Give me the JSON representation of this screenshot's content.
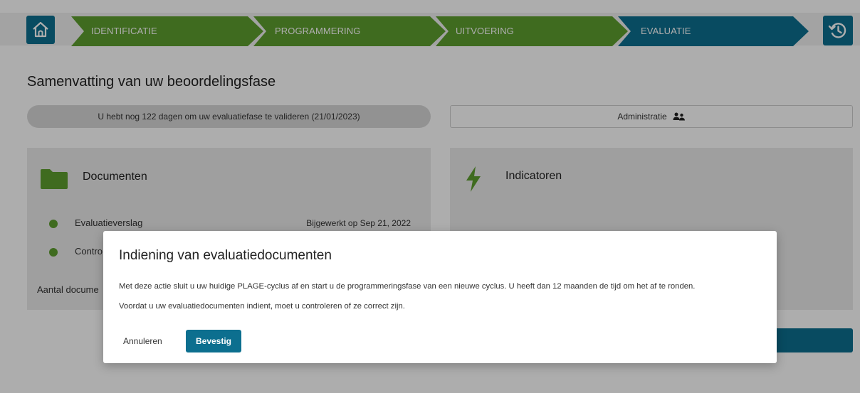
{
  "stepper": {
    "steps": [
      {
        "label": "IDENTIFICATIE",
        "status": "done"
      },
      {
        "label": "PROGRAMMERING",
        "status": "done"
      },
      {
        "label": "UITVOERING",
        "status": "done"
      },
      {
        "label": "EVALUATIE",
        "status": "active"
      }
    ],
    "home_icon": "home-icon",
    "history_icon": "history-icon"
  },
  "page": {
    "title": "Samenvatting van uw beoordelingsfase",
    "deadline_text": "U hebt nog 122 dagen om uw evaluatiefase te valideren (21/01/2023)",
    "admin_label": "Administratie",
    "admin_icon": "users-icon"
  },
  "documents_card": {
    "title": "Documenten",
    "icon": "folder-icon",
    "items": [
      {
        "name": "Evaluatieverslag",
        "status_text": "Bijgewerkt op Sep 21, 2022"
      },
      {
        "name": "Contro",
        "status_text": ""
      }
    ],
    "count_label": "Aantal docume"
  },
  "indicators_card": {
    "title": "Indicatoren",
    "icon": "lightning-icon"
  },
  "modal": {
    "title": "Indiening van evaluatiedocumenten",
    "line1": "Met deze actie sluit u uw huidige PLAGE-cyclus af en start u de programmeringsfase van een nieuwe cyclus. U heeft dan 12 maanden de tijd om het af te ronden.",
    "line2": "Voordat u uw evaluatiedocumenten indient, moet u controleren of ze correct zijn.",
    "cancel_label": "Annuleren",
    "confirm_label": "Bevestig"
  },
  "colors": {
    "primary": "#0c6f8f",
    "green": "#5d9e2e",
    "overlay": "rgba(0,0,0,0.32)"
  }
}
